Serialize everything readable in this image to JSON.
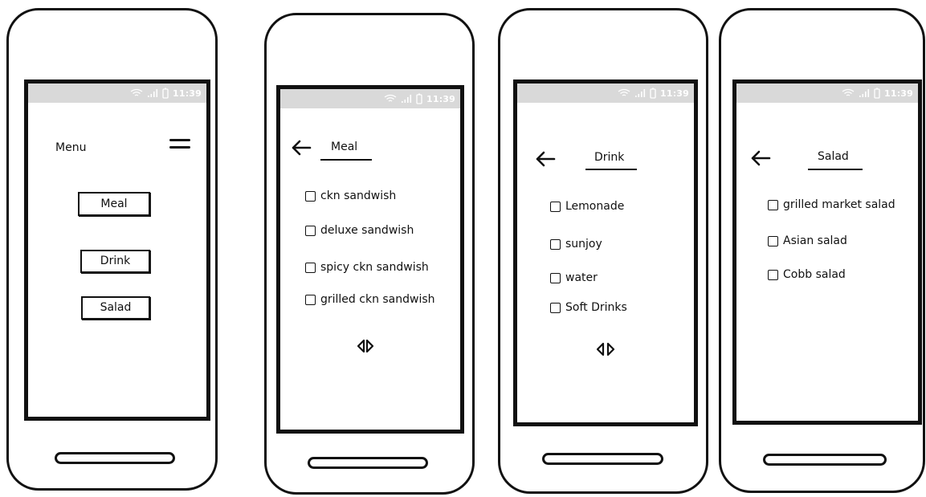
{
  "status_bar": {
    "time": "11:39"
  },
  "screens": {
    "menu": {
      "title": "Menu",
      "buttons": [
        {
          "label": "Meal"
        },
        {
          "label": "Drink"
        },
        {
          "label": "Salad"
        }
      ]
    },
    "meal": {
      "title": "Meal",
      "items": [
        {
          "label": "ckn sandwish",
          "checked": false
        },
        {
          "label": "deluxe sandwish",
          "checked": false
        },
        {
          "label": "spicy ckn sandwish",
          "checked": false
        },
        {
          "label": "grilled ckn sandwish",
          "checked": false
        }
      ]
    },
    "drink": {
      "title": "Drink",
      "items": [
        {
          "label": "Lemonade",
          "checked": false
        },
        {
          "label": "sunjoy",
          "checked": false
        },
        {
          "label": "water",
          "checked": false
        },
        {
          "label": "Soft Drinks",
          "checked": false
        }
      ]
    },
    "salad": {
      "title": "Salad",
      "items": [
        {
          "label": "grilled market salad",
          "checked": false
        },
        {
          "label": "Asian salad",
          "checked": false
        },
        {
          "label": "Cobb salad",
          "checked": false
        }
      ]
    }
  },
  "icons": {
    "back": "left-arrow-icon",
    "menu": "hamburger-icon",
    "pager": "prev-next-icon",
    "wifi": "wifi-icon",
    "signal": "signal-icon",
    "battery": "battery-icon"
  },
  "colors": {
    "ink": "#111111",
    "status_bar": "#d9d9d9",
    "background": "#ffffff"
  }
}
